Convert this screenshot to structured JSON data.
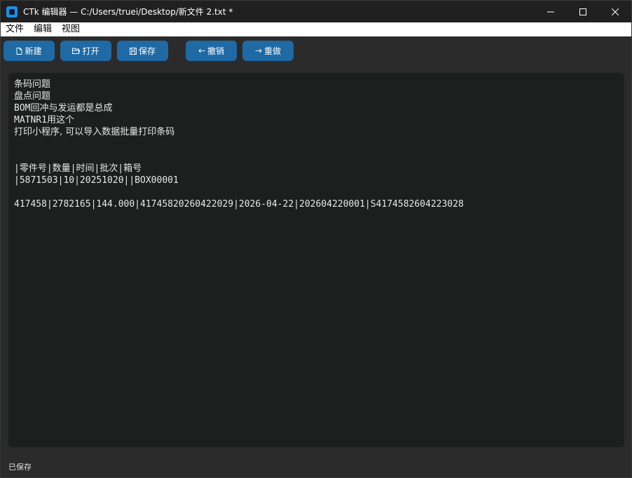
{
  "window": {
    "title": "CTk 编辑器 — C:/Users/truei/Desktop/新文件 2.txt *",
    "app_icon": "ctk-app-icon",
    "controls": {
      "minimize": "minimize-icon",
      "maximize": "maximize-icon",
      "close": "close-icon"
    }
  },
  "menu": {
    "items": [
      {
        "label": "文件"
      },
      {
        "label": "编辑"
      },
      {
        "label": "视图"
      }
    ]
  },
  "toolbar": {
    "new": {
      "label": "新建",
      "icon": "new-file-icon"
    },
    "open": {
      "label": "打开",
      "icon": "folder-open-icon"
    },
    "save": {
      "label": "保存",
      "icon": "save-icon"
    },
    "undo": {
      "label": "撤销",
      "icon": "undo-arrow-icon"
    },
    "redo": {
      "label": "重做",
      "icon": "redo-arrow-icon"
    },
    "button_color": "#1f6aa5"
  },
  "editor": {
    "lines": [
      "条码问题",
      "盘点问题",
      "BOM回冲与发运都是总成",
      "MATNR1用这个",
      "打印小程序, 可以导入数据批量打印条码",
      "",
      "",
      "|零件号|数量|时间|批次|箱号",
      "|5871503|10|20251020||BOX00001",
      "",
      "417458|2782165|144.000|41745820260422029|2026-04-22|202604220001|S4174582604223028"
    ],
    "background": "#1d1e1e"
  },
  "status": {
    "text": "已保存"
  }
}
